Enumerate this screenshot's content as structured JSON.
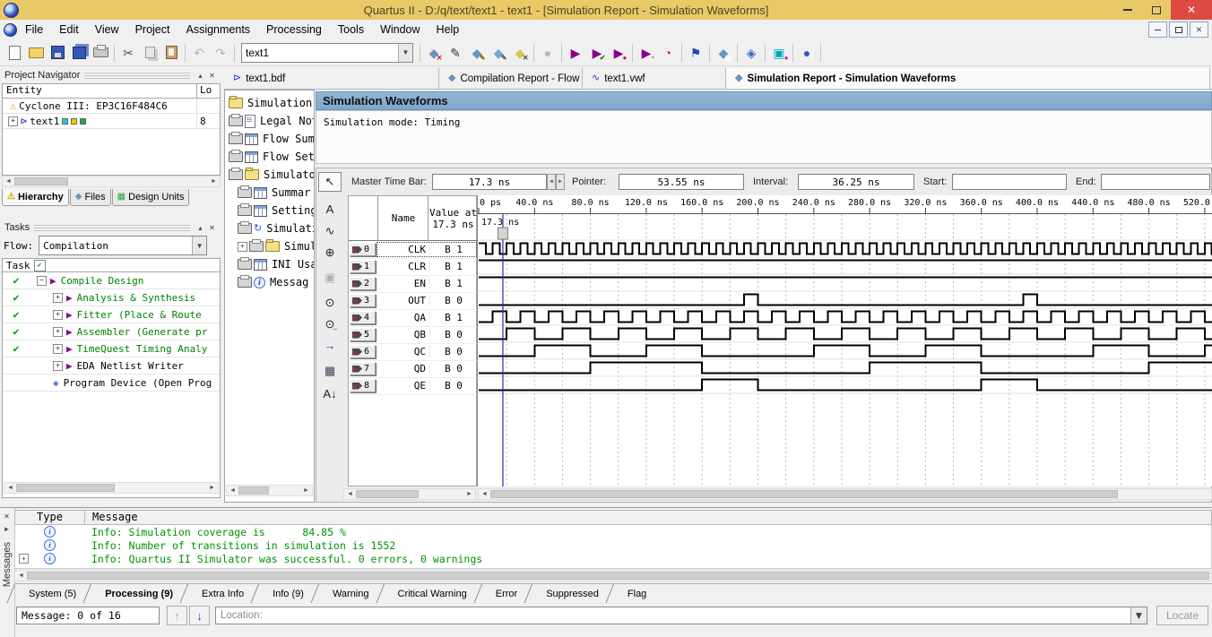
{
  "window": {
    "title": "Quartus II - D:/q/text/text1 - text1 - [Simulation Report - Simulation Waveforms]"
  },
  "menu_items": [
    "File",
    "Edit",
    "View",
    "Project",
    "Assignments",
    "Processing",
    "Tools",
    "Window",
    "Help"
  ],
  "toolbar": {
    "combo_value": "text1",
    "groups_left": [
      [
        "new-file",
        "open-file",
        "save",
        "save-all",
        "print"
      ],
      [
        "cut",
        "copy",
        "paste"
      ],
      [
        "undo",
        "redo"
      ]
    ],
    "groups_right": [
      [
        "assignment-editor",
        "pencil-editor",
        "settings-dialog",
        "assignment-settings",
        "remove-assignments"
      ],
      [
        "stop-processing"
      ],
      [
        "start-compilation",
        "start-analysis-synthesis",
        "start-io-analysis"
      ],
      [
        "start-timequest",
        "timequest-analyzer"
      ],
      [
        "simulator-tool"
      ],
      [
        "compilation-report"
      ],
      [
        "programmer"
      ],
      [
        "chip-planner"
      ],
      [
        "help"
      ]
    ]
  },
  "project_navigator": {
    "title": "Project Navigator",
    "columns": [
      "Entity",
      "Lo"
    ],
    "rows": [
      {
        "icon": "warning",
        "label": "Cyclone III: EP3C16F484C6",
        "lo": "",
        "expand": ""
      },
      {
        "icon": "bdf",
        "label": "text1",
        "lo": "8",
        "expand": "plus",
        "badges": true
      }
    ],
    "tabs": [
      {
        "icon": "warning",
        "label": "Hierarchy",
        "active": true
      },
      {
        "icon": "doc",
        "label": "Files",
        "active": false
      },
      {
        "icon": "design-units",
        "label": "Design Units",
        "active": false
      }
    ]
  },
  "tasks": {
    "title": "Tasks",
    "flow_label": "Flow:",
    "flow_value": "Compilation",
    "column_header": "Task",
    "rows": [
      {
        "check": true,
        "expand": "minus",
        "icon": "play",
        "label": "Compile Design",
        "indent": 0,
        "green": true
      },
      {
        "check": true,
        "expand": "plus",
        "icon": "play",
        "label": "Analysis & Synthesis",
        "indent": 1,
        "green": true
      },
      {
        "check": true,
        "expand": "plus",
        "icon": "play",
        "label": "Fitter (Place & Route",
        "indent": 1,
        "green": true
      },
      {
        "check": true,
        "expand": "plus",
        "icon": "play",
        "label": "Assembler (Generate pr",
        "indent": 1,
        "green": true
      },
      {
        "check": true,
        "expand": "plus",
        "icon": "play",
        "label": "TimeQuest Timing Analy",
        "indent": 1,
        "green": true
      },
      {
        "check": false,
        "expand": "plus",
        "icon": "play",
        "label": "EDA Netlist Writer",
        "indent": 1,
        "green": false
      },
      {
        "check": false,
        "expand": "",
        "icon": "programmer",
        "label": "Program Device (Open Prog",
        "indent": 1,
        "green": false
      }
    ]
  },
  "document_tabs": [
    {
      "icon": "bdf",
      "label": "text1.bdf",
      "active": false
    },
    {
      "icon": "report",
      "label": "Compilation Report - Flow Summary",
      "active": false
    },
    {
      "icon": "vwf",
      "label": "text1.vwf",
      "active": false
    },
    {
      "icon": "report",
      "label": "Simulation Report - Simulation Waveforms",
      "active": true
    }
  ],
  "report_tree": {
    "items": [
      {
        "icons": [
          "folder"
        ],
        "label": "Simulation Rep",
        "indent": 0,
        "expand": ""
      },
      {
        "icons": [
          "printer",
          "doc"
        ],
        "label": "Legal Notic",
        "indent": 0,
        "expand": ""
      },
      {
        "icons": [
          "printer",
          "table"
        ],
        "label": "Flow Summ",
        "indent": 0,
        "expand": ""
      },
      {
        "icons": [
          "printer",
          "table"
        ],
        "label": "Flow Settin",
        "indent": 0,
        "expand": ""
      },
      {
        "icons": [
          "printer",
          "folder"
        ],
        "label": "Simulator",
        "indent": 0,
        "expand": ""
      },
      {
        "icons": [
          "printer",
          "table"
        ],
        "label": "Summar",
        "indent": 1,
        "expand": ""
      },
      {
        "icons": [
          "printer",
          "table"
        ],
        "label": "Settings",
        "indent": 1,
        "expand": ""
      },
      {
        "icons": [
          "printer",
          "refresh"
        ],
        "label": "Simulati",
        "indent": 1,
        "expand": ""
      },
      {
        "icons": [
          "printer",
          "folder"
        ],
        "label": "Simulati",
        "indent": 1,
        "expand": "plus"
      },
      {
        "icons": [
          "printer",
          "table"
        ],
        "label": "INI Usa",
        "indent": 1,
        "expand": ""
      },
      {
        "icons": [
          "printer",
          "info"
        ],
        "label": "Messag",
        "indent": 1,
        "expand": ""
      }
    ]
  },
  "waveform_view": {
    "title": "Simulation Waveforms",
    "mode_line": "Simulation mode: Timing",
    "controls": {
      "master": {
        "label": "Master Time Bar:",
        "value": "17.3 ns"
      },
      "pointer": {
        "label": "Pointer:",
        "value": "53.55 ns"
      },
      "interval": {
        "label": "Interval:",
        "value": "36.25 ns"
      },
      "start": {
        "label": "Start:",
        "value": ""
      },
      "end": {
        "label": "End:",
        "value": ""
      }
    },
    "tools": [
      "selection-tool",
      "text-tool",
      "waveform-edit-tool",
      "zoom-tool",
      "duplicate-tool",
      "find-tool",
      "find-next-tool",
      "goto-tool",
      "snap-tool",
      "sort-tool"
    ],
    "table": {
      "name_header": "Name",
      "value_header": "Value at\n17.3 ns"
    }
  },
  "chart_data": {
    "type": "line",
    "title": "Simulation Waveforms",
    "x_axis": {
      "unit": "ns",
      "tick_labels": [
        "0 ps",
        "40.0 ns",
        "80.0 ns",
        "120.0 ns",
        "160.0 ns",
        "200.0 ns",
        "240.0 ns",
        "280.0 ns",
        "320.0 ns",
        "360.0 ns",
        "400.0 ns",
        "440.0 ns",
        "480.0 ns",
        "520.0 ns"
      ],
      "tick_interval_ns": 40,
      "visible_range_ns": [
        0,
        527
      ],
      "grid_minor_interval_ns": 20
    },
    "cursor": {
      "master_time_ns": 17.3,
      "label": "17.3 ns"
    },
    "signals": [
      {
        "index": 0,
        "direction": "input",
        "name": "CLK",
        "value_at_cursor": "B 1",
        "wave": {
          "type": "clock",
          "period_ns": 10,
          "duty": 0.5,
          "start_level": 1
        }
      },
      {
        "index": 1,
        "direction": "input",
        "name": "CLR",
        "value_at_cursor": "B 1",
        "wave": {
          "type": "const",
          "level": 1
        }
      },
      {
        "index": 2,
        "direction": "input",
        "name": "EN",
        "value_at_cursor": "B 1",
        "wave": {
          "type": "const",
          "level": 1
        }
      },
      {
        "index": 3,
        "direction": "output",
        "name": "OUT",
        "value_at_cursor": "B 0",
        "wave": {
          "type": "pattern",
          "period_ns": 200,
          "high_ns": [
            [
              190,
              200
            ]
          ]
        }
      },
      {
        "index": 4,
        "direction": "output",
        "name": "QA",
        "value_at_cursor": "B 1",
        "wave": {
          "type": "pattern",
          "period_ns": 20,
          "high_ns": [
            [
              10,
              20
            ]
          ]
        }
      },
      {
        "index": 5,
        "direction": "output",
        "name": "QB",
        "value_at_cursor": "B 0",
        "wave": {
          "type": "pattern",
          "period_ns": 40,
          "high_ns": [
            [
              20,
              40
            ]
          ]
        }
      },
      {
        "index": 6,
        "direction": "output",
        "name": "QC",
        "value_at_cursor": "B 0",
        "wave": {
          "type": "pattern",
          "period_ns": 200,
          "high_ns": [
            [
              40,
              80
            ],
            [
              120,
              160
            ]
          ]
        }
      },
      {
        "index": 7,
        "direction": "output",
        "name": "QD",
        "value_at_cursor": "B 0",
        "wave": {
          "type": "pattern",
          "period_ns": 200,
          "high_ns": [
            [
              80,
              160
            ]
          ]
        }
      },
      {
        "index": 8,
        "direction": "output",
        "name": "QE",
        "value_at_cursor": "B 0",
        "wave": {
          "type": "pattern",
          "period_ns": 200,
          "high_ns": [
            [
              160,
              200
            ]
          ]
        }
      }
    ]
  },
  "messages": {
    "side_label": "Messages",
    "columns": [
      "Type",
      "Message"
    ],
    "rows": [
      {
        "icon": "info",
        "expand": false,
        "text": "Info: Simulation coverage is      84.85 %"
      },
      {
        "icon": "info",
        "expand": false,
        "text": "Info: Number of transitions in simulation is 1552"
      },
      {
        "icon": "info",
        "expand": true,
        "text": "Info: Quartus II Simulator was successful. 0 errors, 0 warnings"
      }
    ],
    "tabs": [
      {
        "label": "System (5)",
        "active": false
      },
      {
        "label": "Processing (9)",
        "active": true
      },
      {
        "label": "Extra Info",
        "active": false
      },
      {
        "label": "Info (9)",
        "active": false
      },
      {
        "label": "Warning",
        "active": false
      },
      {
        "label": "Critical Warning",
        "active": false
      },
      {
        "label": "Error",
        "active": false
      },
      {
        "label": "Suppressed",
        "active": false
      },
      {
        "label": "Flag",
        "active": false
      }
    ],
    "status": {
      "message_counter": "Message: 0 of 16",
      "location_label": "Location:",
      "locate_button": "Locate"
    }
  },
  "colors": {
    "title_bar": "#e9c868",
    "close_button": "#dd4a42",
    "waveform_header": "#7da7ca",
    "task_done_text": "#008000",
    "message_info_text": "#009400",
    "cursor_line": "#2a2ab8",
    "play_icon": "#880088"
  }
}
